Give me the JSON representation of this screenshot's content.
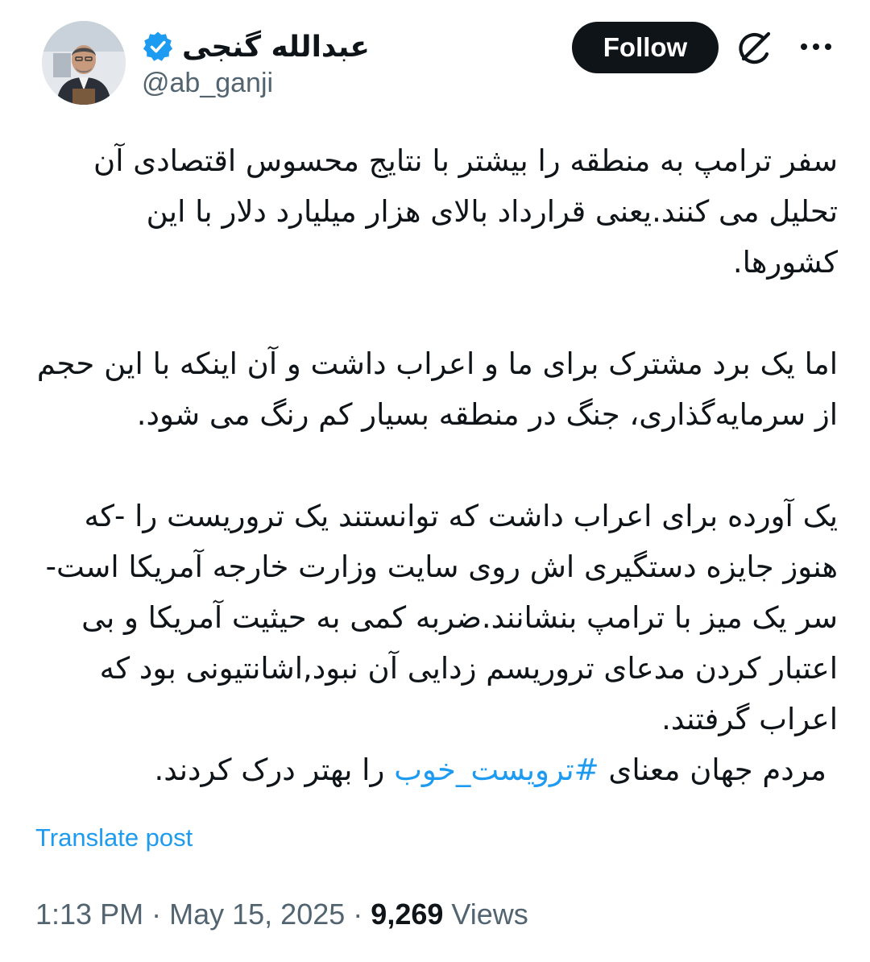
{
  "author": {
    "display_name": "عبدالله گنجی",
    "handle": "@ab_ganji",
    "verified": true,
    "avatar_icon": "profile-photo"
  },
  "actions": {
    "follow_label": "Follow",
    "grok_icon": "grok-icon",
    "more_icon": "more-icon"
  },
  "tweet": {
    "paragraphs": [
      "سفر ترامپ به منطقه را بیشتر با نتایج محسوس اقتصادی آن تحلیل می کنند.یعنی قرارداد بالای هزار میلیارد دلار با این کشورها.",
      "اما یک برد مشترک برای ما و اعراب داشت و آن اینکه با این حجم از سرمایه‌گذاری، جنگ در منطقه بسیار کم رنگ می شود.",
      "یک آورده برای اعراب داشت که توانستند یک تروریست را -که هنوز جایزه دستگیری اش روی سایت وزارت خارجه آمریکا است-سر یک میز با ترامپ بنشانند.ضربه کمی به حیثیت آمریکا و بی اعتبار کردن مدعای تروریسم زدایی آن نبود,اشانتیونی بود که اعراب گرفتند."
    ],
    "last_line_before": "مردم جهان معنای",
    "hashtag": "#ترویست_خوب",
    "last_line_after": "را بهتر درک کردند."
  },
  "translate_label": "Translate post",
  "meta": {
    "time": "1:13 PM",
    "date": "May 15, 2025",
    "separator": "·",
    "views_count": "9,269",
    "views_label": "Views"
  },
  "colors": {
    "text": "#0f1419",
    "secondary": "#536471",
    "link": "#1d9bf0",
    "button_bg": "#0f1419"
  }
}
